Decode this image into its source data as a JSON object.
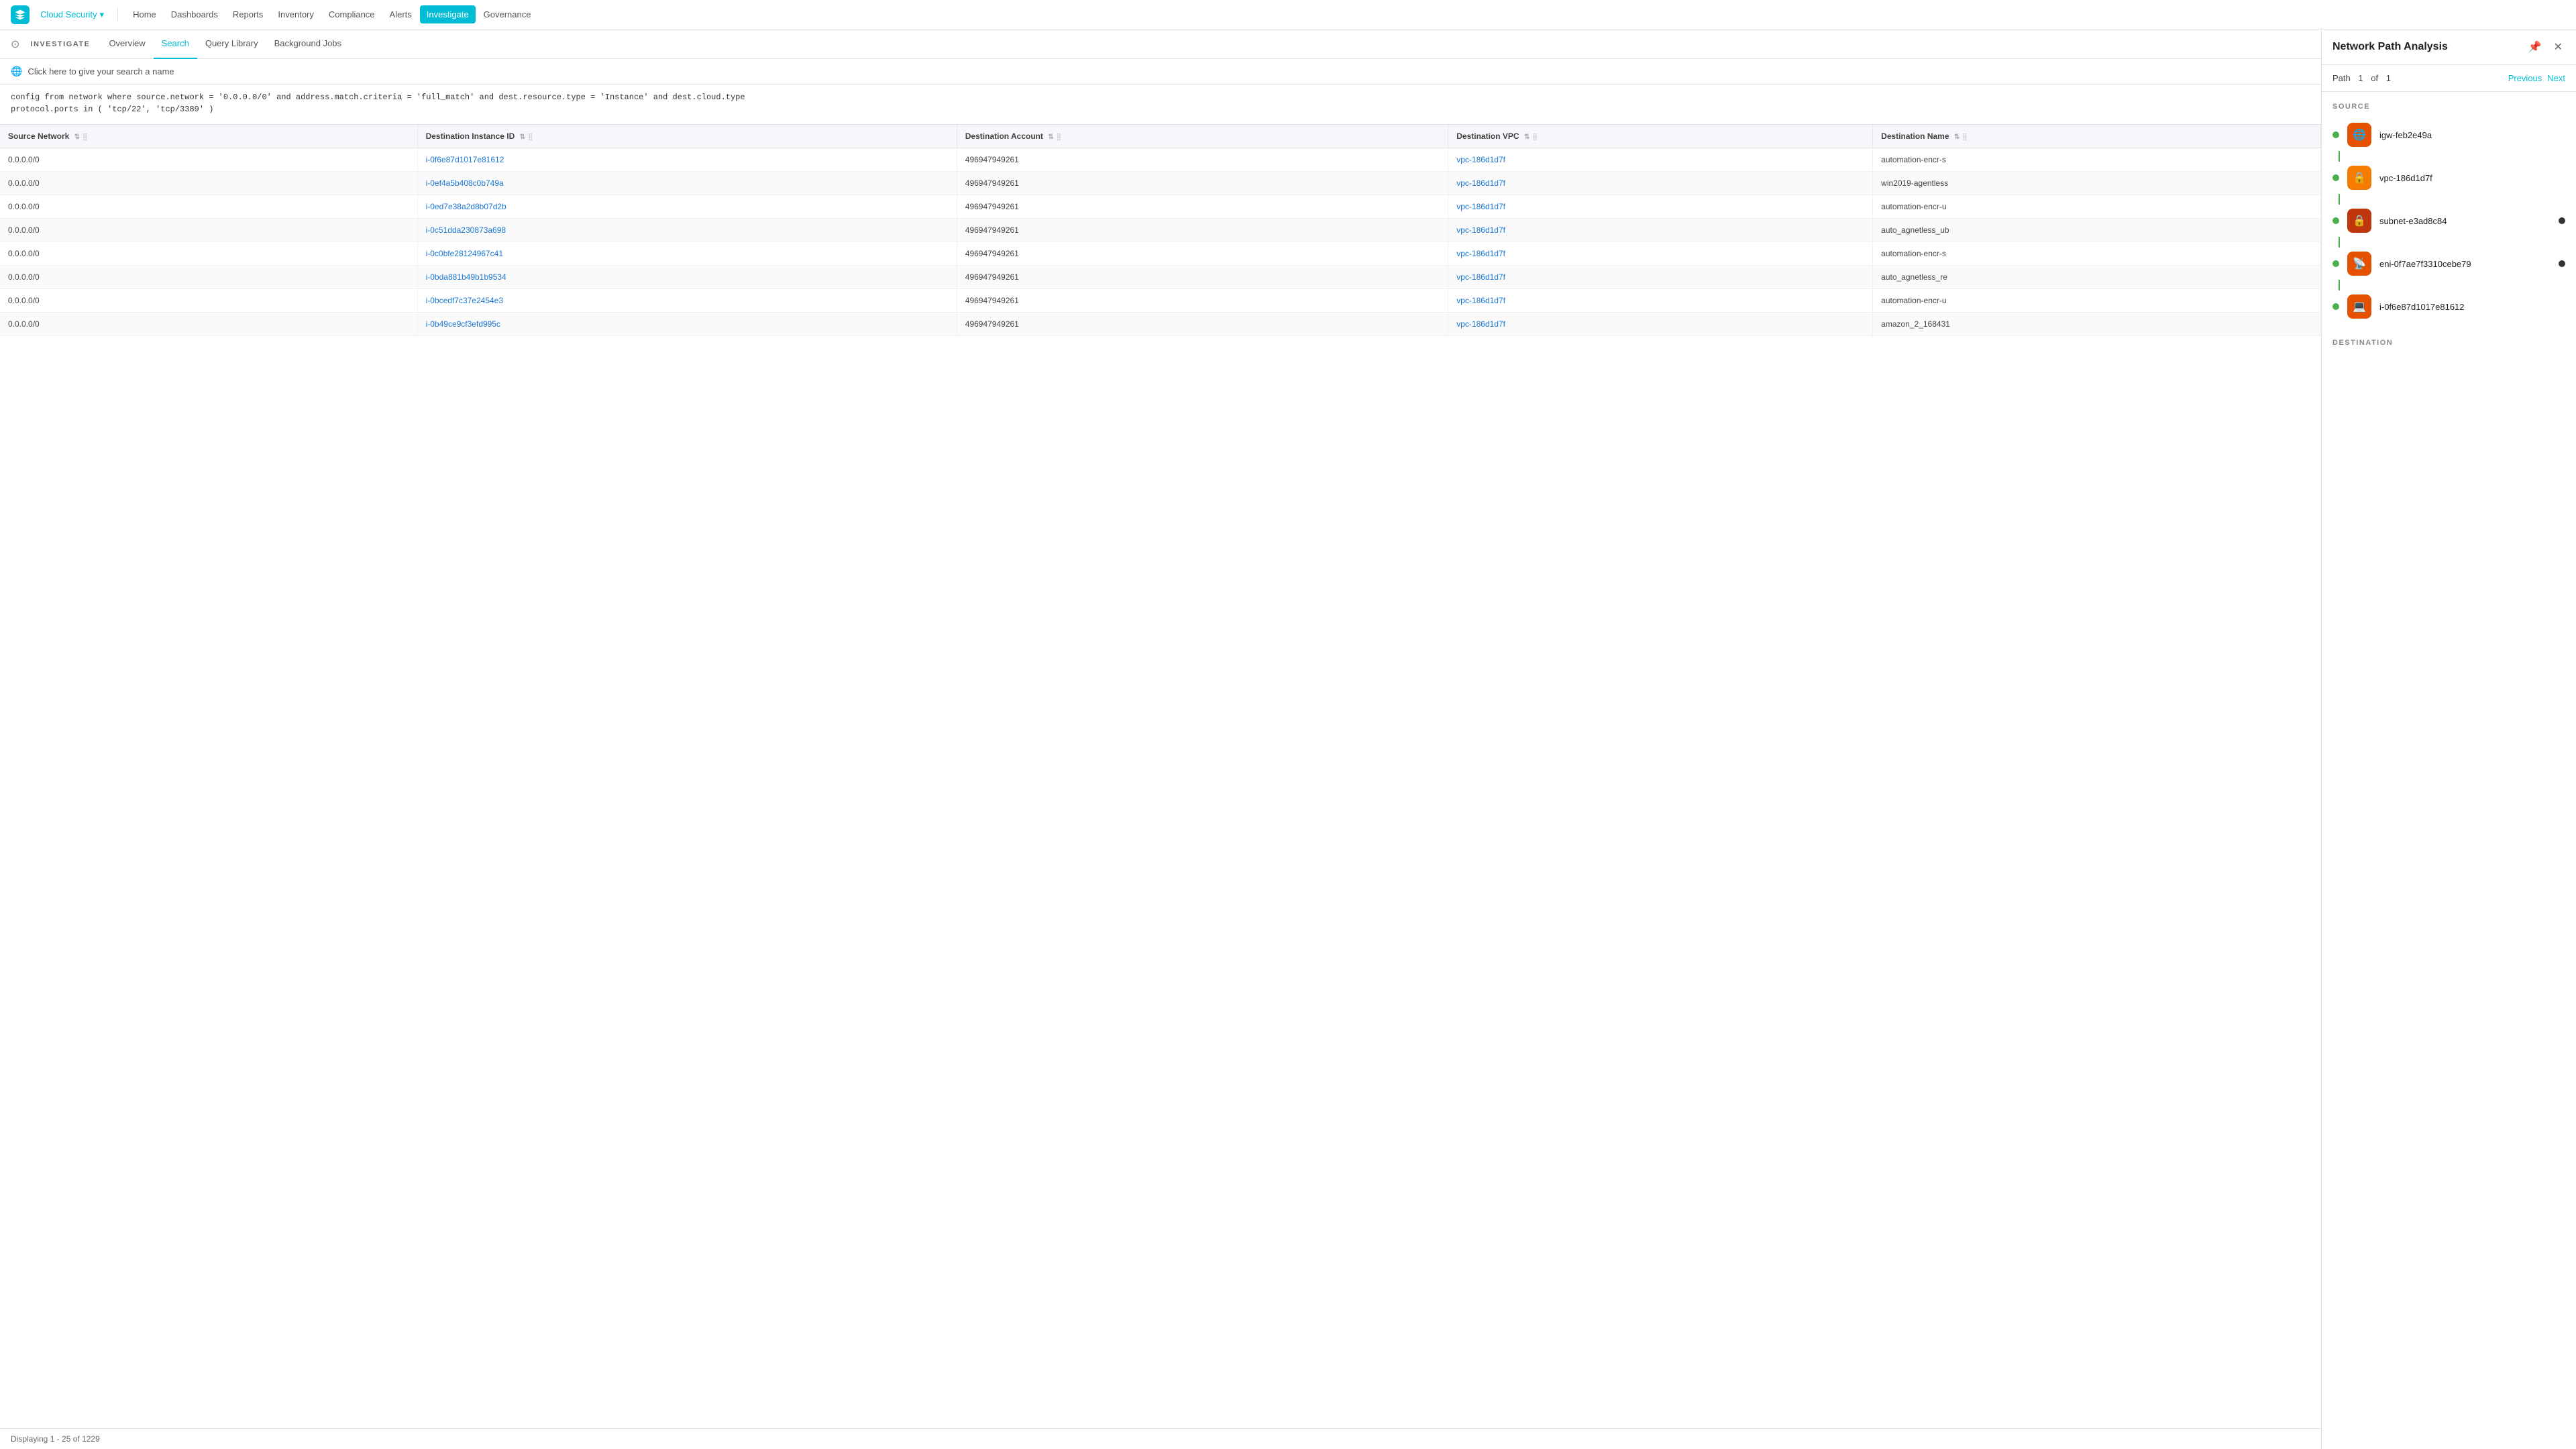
{
  "app": {
    "logo_alt": "Prisma Cloud Logo",
    "cloud_security_label": "Cloud Security",
    "nav_items": [
      {
        "label": "Home",
        "active": false
      },
      {
        "label": "Dashboards",
        "active": false
      },
      {
        "label": "Reports",
        "active": false
      },
      {
        "label": "Inventory",
        "active": false
      },
      {
        "label": "Compliance",
        "active": false
      },
      {
        "label": "Alerts",
        "active": false
      },
      {
        "label": "Investigate",
        "active": true
      },
      {
        "label": "Governance",
        "active": false
      }
    ]
  },
  "investigate": {
    "section_label": "INVESTIGATE",
    "tabs": [
      {
        "label": "Overview",
        "active": false
      },
      {
        "label": "Search",
        "active": true
      },
      {
        "label": "Query Library",
        "active": false
      },
      {
        "label": "Background Jobs",
        "active": false
      }
    ]
  },
  "search": {
    "name_placeholder": "Click here to give your search a name",
    "query": "config from network where source.network = '0.0.0.0/0' and address.match.criteria = 'full_match' and dest.resource.type = 'Instance' and dest.cloud.type\nprotocol.ports in ( 'tcp/22', 'tcp/3389' )"
  },
  "table": {
    "columns": [
      {
        "label": "Source Network",
        "key": "source_network"
      },
      {
        "label": "Destination Instance ID",
        "key": "dest_instance_id"
      },
      {
        "label": "Destination Account",
        "key": "dest_account"
      },
      {
        "label": "Destination VPC",
        "key": "dest_vpc"
      },
      {
        "label": "Destination Name",
        "key": "dest_name"
      }
    ],
    "rows": [
      {
        "source_network": "0.0.0.0/0",
        "dest_instance_id": "i-0f6e87d1017e81612",
        "dest_account": "496947949261",
        "dest_vpc": "vpc-186d1d7f",
        "dest_name": "automation-encr-s"
      },
      {
        "source_network": "0.0.0.0/0",
        "dest_instance_id": "i-0ef4a5b408c0b749a",
        "dest_account": "496947949261",
        "dest_vpc": "vpc-186d1d7f",
        "dest_name": "win2019-agentless"
      },
      {
        "source_network": "0.0.0.0/0",
        "dest_instance_id": "i-0ed7e38a2d8b07d2b",
        "dest_account": "496947949261",
        "dest_vpc": "vpc-186d1d7f",
        "dest_name": "automation-encr-u"
      },
      {
        "source_network": "0.0.0.0/0",
        "dest_instance_id": "i-0c51dda230873a698",
        "dest_account": "496947949261",
        "dest_vpc": "vpc-186d1d7f",
        "dest_name": "auto_agnetless_ub"
      },
      {
        "source_network": "0.0.0.0/0",
        "dest_instance_id": "i-0c0bfe28124967c41",
        "dest_account": "496947949261",
        "dest_vpc": "vpc-186d1d7f",
        "dest_name": "automation-encr-s"
      },
      {
        "source_network": "0.0.0.0/0",
        "dest_instance_id": "i-0bda881b49b1b9534",
        "dest_account": "496947949261",
        "dest_vpc": "vpc-186d1d7f",
        "dest_name": "auto_agnetless_re"
      },
      {
        "source_network": "0.0.0.0/0",
        "dest_instance_id": "i-0bcedf7c37e2454e3",
        "dest_account": "496947949261",
        "dest_vpc": "vpc-186d1d7f",
        "dest_name": "automation-encr-u"
      },
      {
        "source_network": "0.0.0.0/0",
        "dest_instance_id": "i-0b49ce9cf3efd995c",
        "dest_account": "496947949261",
        "dest_vpc": "vpc-186d1d7f",
        "dest_name": "amazon_2_168431"
      }
    ],
    "status": "Displaying 1 - 25 of 1229"
  },
  "network_path": {
    "panel_title": "Network Path Analysis",
    "path_label": "Path",
    "current": "1",
    "separator": "of",
    "total": "1",
    "prev_label": "Previous",
    "next_label": "Next",
    "source_label": "SOURCE",
    "destination_label": "DESTINATION",
    "nodes": [
      {
        "name": "igw-feb2e49a",
        "icon_type": "igw",
        "has_dot": false
      },
      {
        "name": "vpc-186d1d7f",
        "icon_type": "vpc",
        "has_dot": false
      },
      {
        "name": "subnet-e3ad8c84",
        "icon_type": "subnet",
        "has_dot": true
      },
      {
        "name": "eni-0f7ae7f3310cebe79",
        "icon_type": "eni",
        "has_dot": true
      },
      {
        "name": "i-0f6e87d1017e81612",
        "icon_type": "instance",
        "has_dot": false
      }
    ]
  }
}
